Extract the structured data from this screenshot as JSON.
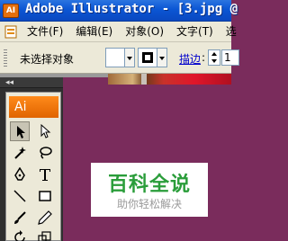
{
  "window": {
    "title": "Adobe Illustrator - [3.jpg @",
    "app_icon_label": "AI"
  },
  "menubar": {
    "items": [
      {
        "label": "文件(F)"
      },
      {
        "label": "编辑(E)"
      },
      {
        "label": "对象(O)"
      },
      {
        "label": "文字(T)"
      },
      {
        "label": "选"
      }
    ]
  },
  "controlbar": {
    "selection_status": "未选择对象",
    "stroke_label": "描边",
    "stroke_colon": ":",
    "stroke_weight": "1"
  },
  "toolbox": {
    "collapse_label": "◂◂",
    "logo_label": "Ai",
    "tools": [
      {
        "name": "selection-tool-icon"
      },
      {
        "name": "direct-selection-tool-icon"
      },
      {
        "name": "magic-wand-tool-icon"
      },
      {
        "name": "lasso-tool-icon"
      },
      {
        "name": "pen-tool-icon"
      },
      {
        "name": "type-tool-icon"
      },
      {
        "name": "line-segment-tool-icon"
      },
      {
        "name": "rectangle-tool-icon"
      },
      {
        "name": "paintbrush-tool-icon"
      },
      {
        "name": "pencil-tool-icon"
      },
      {
        "name": "rotate-tool-icon"
      },
      {
        "name": "scale-tool-icon"
      }
    ]
  },
  "canvas": {
    "watermark_title": "百科全说",
    "watermark_subtitle": "助你轻松解决"
  },
  "colors": {
    "titlebar": "#0b56d4",
    "canvas_background": "#7a2c5c",
    "watermark_green": "#2a9d3a",
    "ai_orange": "#ff8a1a"
  }
}
